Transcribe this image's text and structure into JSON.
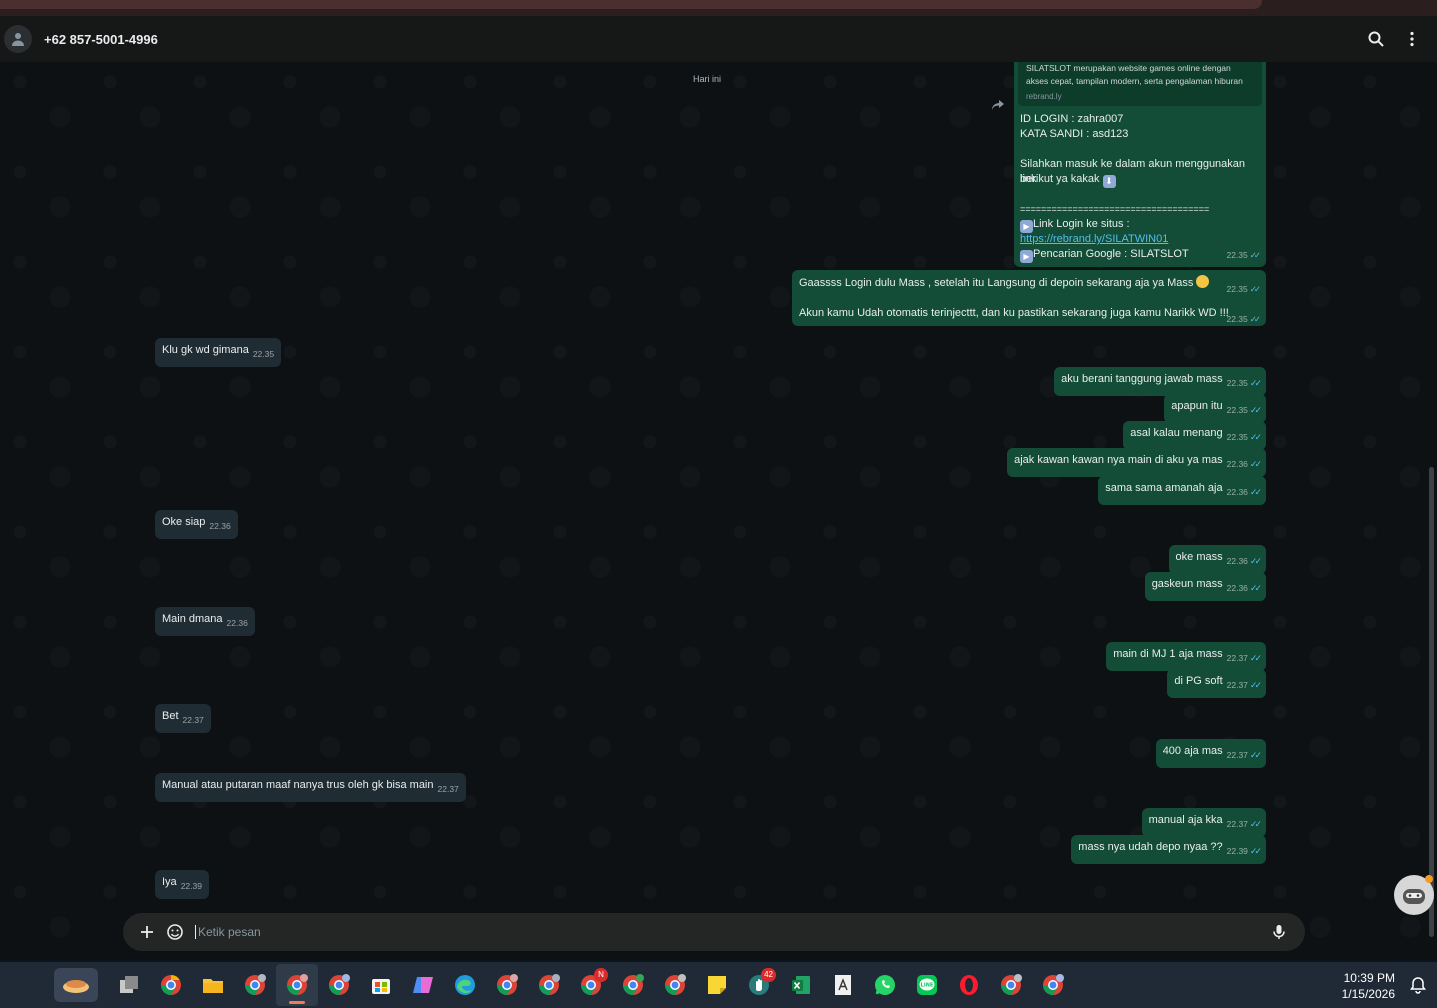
{
  "header": {
    "contact": "+62 857-5001-4996"
  },
  "chat": {
    "date_chip": "Hari ini",
    "forwarded": {
      "preview_lines": [
        "SILATSLOT merupakan website games online dengan",
        "akses cepat, tampilan modern, serta pengalaman hiburan"
      ],
      "preview_domain": "rebrand.ly",
      "lines": [
        "ID LOGIN : zahra007",
        "KATA SANDI : asd123",
        "",
        "Silahkan masuk ke dalam akun menggunakan link",
        "berikut ya kakak",
        "",
        "====================================",
        "Link Login ke situs  :"
      ],
      "link": "https://rebrand.ly/SILATWIN01",
      "last_line": "Pencarian Google : SILATSLOT",
      "time": "22.35"
    },
    "promo": {
      "line1": "Gaassss Login dulu Mass  , setelah itu Langsung di depoin sekarang aja ya Mass",
      "line2": " Akun kamu Udah otomatis terinjecttt, dan ku pastikan sekarang juga kamu Narikk WD !!!",
      "time1": "22.35",
      "time2": "22.35"
    },
    "messages": [
      {
        "dir": "in",
        "text": "Klu gk wd gimana",
        "time": "22.35"
      },
      {
        "dir": "out",
        "text": "aku berani tanggung jawab mass",
        "time": "22.35"
      },
      {
        "dir": "out",
        "text": "apapun itu",
        "time": "22.35"
      },
      {
        "dir": "out",
        "text": "asal kalau menang",
        "time": "22.35"
      },
      {
        "dir": "out",
        "text": "ajak kawan kawan nya main di aku ya mas",
        "time": "22.36"
      },
      {
        "dir": "out",
        "text": "sama sama amanah aja",
        "time": "22.36"
      },
      {
        "dir": "in",
        "text": "Oke siap",
        "time": "22.36"
      },
      {
        "dir": "out",
        "text": "oke mass",
        "time": "22.36"
      },
      {
        "dir": "out",
        "text": "gaskeun mass",
        "time": "22.36"
      },
      {
        "dir": "in",
        "text": "Main dmana",
        "time": "22.36"
      },
      {
        "dir": "out",
        "text": "main di MJ 1 aja mass",
        "time": "22.37"
      },
      {
        "dir": "out",
        "text": "di PG soft",
        "time": "22.37"
      },
      {
        "dir": "in",
        "text": "Bet",
        "time": "22.37"
      },
      {
        "dir": "out",
        "text": "400 aja mas",
        "time": "22.37"
      },
      {
        "dir": "in",
        "text": "Manual atau putaran maaf nanya trus oleh gk bisa main",
        "time": "22.37"
      },
      {
        "dir": "out",
        "text": "manual aja kka",
        "time": "22.37"
      },
      {
        "dir": "out",
        "text": "mass nya udah depo nyaa ??",
        "time": "22.39"
      },
      {
        "dir": "in",
        "text": "Iya",
        "time": "22.39"
      }
    ]
  },
  "composer": {
    "placeholder": "Ketik pesan"
  },
  "taskbar": {
    "badge_n": "N",
    "badge_count": "42",
    "time": "10:39 PM",
    "date": "1/15/2026"
  },
  "colors": {
    "incoming": "#202c33",
    "outgoing": "#144d37",
    "link": "#53bdeb",
    "background": "#0b141a"
  }
}
